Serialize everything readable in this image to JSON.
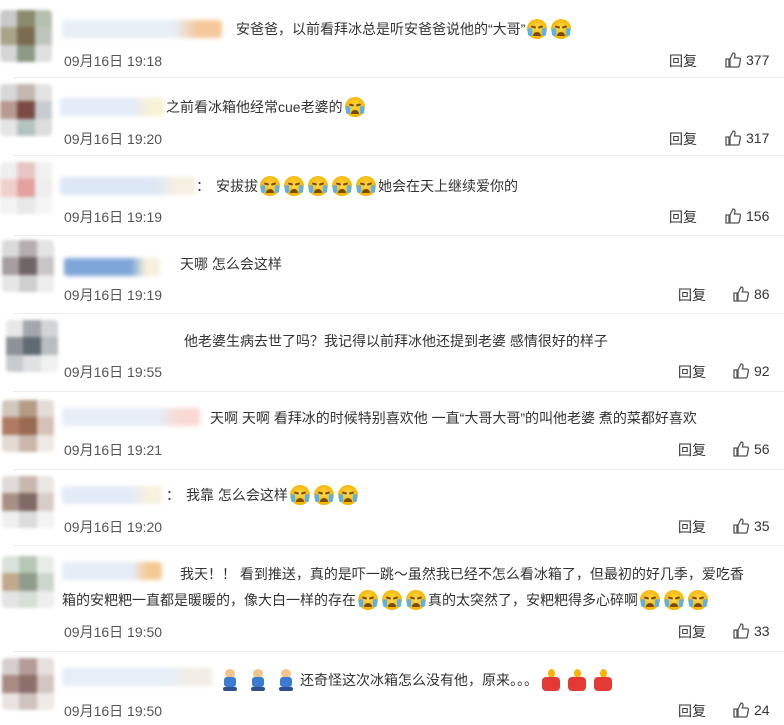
{
  "comments": [
    {
      "avatar_colors": [
        "#c9c9c9",
        "#8b8b6e",
        "#b7bfb0",
        "#a8a48a",
        "#7a6b52",
        "#bfc5bc",
        "#d6d6d6",
        "#8d9a85",
        "#e0e0e0"
      ],
      "name_colors": [
        "#e9eff7",
        "#f5c89a"
      ],
      "segments": [
        {
          "t": "text",
          "v": "安爸爸，以前看拜冰总是听安爸爸说他的“大哥”"
        },
        {
          "t": "emoji",
          "v": "crying-face"
        },
        {
          "t": "emoji",
          "v": "crying-face"
        }
      ],
      "time": "09月16日 19:18",
      "reply": "回复",
      "likes": "377"
    },
    {
      "avatar_colors": [
        "#d8d8d8",
        "#c2b8b0",
        "#e3e3e3",
        "#b89a92",
        "#7b4a44",
        "#c7ccd0",
        "#e5e5e5",
        "#b4c4c0",
        "#dddddd"
      ],
      "name_colors": [
        "#e3ecf7",
        "#f7f1d8"
      ],
      "segments": [
        {
          "t": "text",
          "v": "之前看冰箱他经常cue老婆的"
        },
        {
          "t": "emoji",
          "v": "crying-face"
        }
      ],
      "time": "09月16日 19:20",
      "reply": "回复",
      "likes": "317"
    },
    {
      "avatar_colors": [
        "#efefef",
        "#e7c6c4",
        "#f1f1f1",
        "#f0d0cc",
        "#e6a0a0",
        "#eeeeee",
        "#f3f3f3",
        "#e9e9e9",
        "#f5f5f5"
      ],
      "name_colors": [
        "#dde8f6",
        "#f6efe2"
      ],
      "segments": [
        {
          "t": "colon",
          "v": "："
        },
        {
          "t": "text",
          "v": "安拔拔"
        },
        {
          "t": "emoji",
          "v": "crying-face"
        },
        {
          "t": "emoji",
          "v": "crying-face"
        },
        {
          "t": "emoji",
          "v": "crying-face"
        },
        {
          "t": "emoji",
          "v": "crying-face"
        },
        {
          "t": "emoji",
          "v": "crying-face"
        },
        {
          "t": "text",
          "v": "她会在天上继续爱你的"
        }
      ],
      "time": "09月16日 19:19",
      "reply": "回复",
      "likes": "156"
    },
    {
      "avatar_colors": [
        "#dadada",
        "#b4aeb0",
        "#e4e4e4",
        "#a69ea0",
        "#6f6466",
        "#c9c5c6",
        "#e6e6e6",
        "#cfcfcf",
        "#ededed"
      ],
      "name_colors": [
        "#7fa6d9",
        "#f7f0dc"
      ],
      "segments": [
        {
          "t": "text",
          "v": "天哪 怎么会这样"
        }
      ],
      "time": "09月16日 19:19",
      "reply": "回复",
      "likes": "86"
    },
    {
      "avatar_colors": [
        "#e8e8e8",
        "#a3a7ab",
        "#d2d4d6",
        "#8e9296",
        "#5f6a73",
        "#b9bdc0",
        "#c8cbcd",
        "#dfe1e3",
        "#f0f0f0"
      ],
      "name_colors": [
        "#ffffff",
        "#ffffff"
      ],
      "segments": [
        {
          "t": "text",
          "v": "他老婆生病去世了吗？我记得以前拜冰他还提到老婆 感情很好的样子"
        }
      ],
      "time": "09月16日 19:55",
      "reply": "回复",
      "likes": "92"
    },
    {
      "avatar_colors": [
        "#d2c7bd",
        "#b59c86",
        "#e3ddd7",
        "#b07b62",
        "#9a6a52",
        "#d4c2b6",
        "#e2dad3",
        "#c9b8ab",
        "#efe9e4"
      ],
      "name_colors": [
        "#e7eef8",
        "#f9d9d4"
      ],
      "segments": [
        {
          "t": "text",
          "v": "天啊 天啊 看拜冰的时候特别喜欢他 一直“大哥大哥”的叫他老婆 煮的菜都好喜欢"
        }
      ],
      "time": "09月16日 19:21",
      "reply": "回复",
      "likes": "56"
    },
    {
      "avatar_colors": [
        "#e0dbd8",
        "#c9b7ae",
        "#ebe7e4",
        "#a88f86",
        "#7f6a64",
        "#d8ccc7",
        "#efefef",
        "#dcdcdc",
        "#f3f3f3"
      ],
      "name_colors": [
        "#e4ecf7",
        "#f7f1de"
      ],
      "segments": [
        {
          "t": "colon",
          "v": "："
        },
        {
          "t": "text",
          "v": "我靠 怎么会这样"
        },
        {
          "t": "emoji",
          "v": "crying-face"
        },
        {
          "t": "emoji",
          "v": "crying-face"
        },
        {
          "t": "emoji",
          "v": "crying-face"
        }
      ],
      "time": "09月16日 19:20",
      "reply": "回复",
      "likes": "35"
    },
    {
      "avatar_colors": [
        "#d9e3d9",
        "#b7c7b5",
        "#e8eee7",
        "#c1a98e",
        "#8f9c8c",
        "#ccd6cb",
        "#e4e4e4",
        "#d8dfd6",
        "#eeeeee"
      ],
      "name_colors": [
        "#e5edf7",
        "#f6c993"
      ],
      "line1": "我天！！ 看到推送，真的是吓一跳～虽然我已经不怎么看冰箱了，但最初的好几季，爱吃香",
      "segments": [
        {
          "t": "text",
          "v": "箱的安粑粑一直都是暖暖的，像大白一样的存在"
        },
        {
          "t": "emoji",
          "v": "crying-face"
        },
        {
          "t": "emoji",
          "v": "crying-face"
        },
        {
          "t": "emoji",
          "v": "crying-face"
        },
        {
          "t": "text",
          "v": "真的太突然了，安粑粑得多心碎啊"
        },
        {
          "t": "emoji",
          "v": "crying-face"
        },
        {
          "t": "emoji",
          "v": "crying-face"
        },
        {
          "t": "emoji",
          "v": "crying-face"
        }
      ],
      "time": "09月16日 19:50",
      "reply": "回复",
      "likes": "33"
    },
    {
      "avatar_colors": [
        "#d6cfcd",
        "#b49c98",
        "#e6e0de",
        "#a98b86",
        "#8c6f6b",
        "#d2c5c2",
        "#e8e3e1",
        "#cfc2bf",
        "#efe9e7"
      ],
      "name_colors": [
        "#e6eef8",
        "#f1ede6"
      ],
      "segments": [
        {
          "t": "figure",
          "v": "bowing-figure"
        },
        {
          "t": "figure",
          "v": "bowing-figure"
        },
        {
          "t": "figure",
          "v": "bowing-figure"
        },
        {
          "t": "text",
          "v": "还奇怪这次冰箱怎么没有他，原来。。。"
        },
        {
          "t": "candle",
          "v": "candle"
        },
        {
          "t": "candle",
          "v": "candle"
        },
        {
          "t": "candle",
          "v": "candle"
        }
      ],
      "time": "09月16日 19:50",
      "reply": "回复",
      "likes": "24"
    }
  ]
}
